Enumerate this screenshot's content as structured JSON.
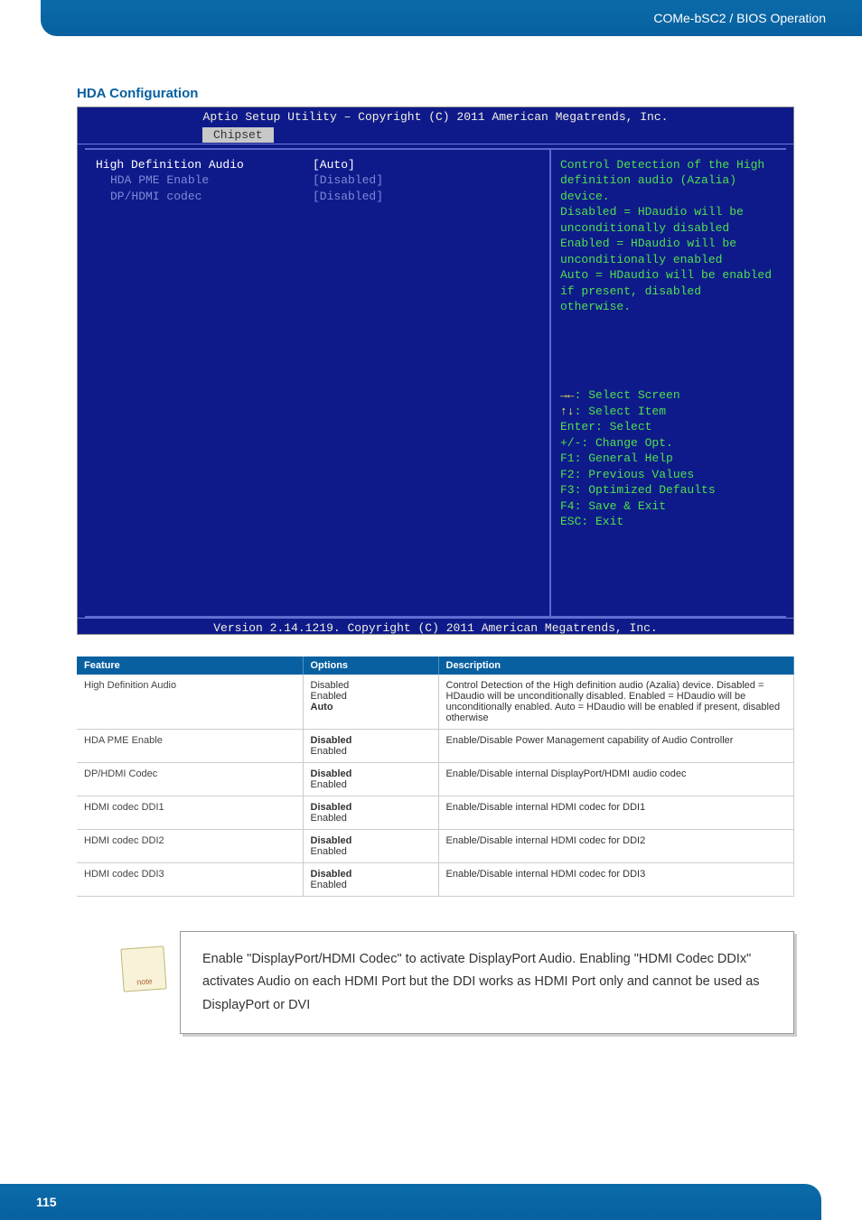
{
  "header": {
    "breadcrumb": "COMe-bSC2 / BIOS Operation"
  },
  "section_title": "HDA Configuration",
  "bios": {
    "top_bar": "Aptio Setup Utility – Copyright (C) 2011 American Megatrends, Inc.",
    "tab": "Chipset",
    "settings": [
      {
        "label": "High Definition Audio",
        "value": "[Auto]",
        "selected": true,
        "indent": false
      },
      {
        "label": "HDA PME Enable",
        "value": "[Disabled]",
        "selected": false,
        "indent": true
      },
      {
        "label": "DP/HDMI codec",
        "value": "[Disabled]",
        "selected": false,
        "indent": true
      }
    ],
    "help_top": [
      "Control Detection of the High",
      "definition audio (Azalia)",
      "device.",
      "Disabled = HDaudio will be",
      "unconditionally disabled",
      "Enabled = HDaudio will be",
      "unconditionally enabled",
      "Auto = HDaudio will be enabled",
      "if present, disabled otherwise."
    ],
    "help_bottom": [
      {
        "key": "→←",
        "txt": ": Select Screen",
        "keyclass": "yellow"
      },
      {
        "key": "↑↓",
        "txt": ": Select Item",
        "keyclass": "yellow"
      },
      {
        "key": "Enter",
        "txt": ": Select",
        "keyclass": "green"
      },
      {
        "key": "+/-",
        "txt": ": Change Opt.",
        "keyclass": "green"
      },
      {
        "key": "F1",
        "txt": ": General Help",
        "keyclass": "green"
      },
      {
        "key": "F2",
        "txt": ": Previous Values",
        "keyclass": "green"
      },
      {
        "key": "F3",
        "txt": ": Optimized Defaults",
        "keyclass": "green"
      },
      {
        "key": "F4",
        "txt": ": Save & Exit",
        "keyclass": "green"
      },
      {
        "key": "ESC",
        "txt": ": Exit",
        "keyclass": "green"
      }
    ],
    "footer": "Version 2.14.1219. Copyright (C) 2011 American Megatrends, Inc."
  },
  "table": {
    "headers": {
      "feature": "Feature",
      "options": "Options",
      "description": "Description"
    },
    "rows": [
      {
        "feature": "High Definition Audio",
        "options": [
          {
            "t": "Disabled",
            "b": false
          },
          {
            "t": "Enabled",
            "b": false
          },
          {
            "t": "Auto",
            "b": true
          }
        ],
        "description": "Control Detection of the High definition audio (Azalia) device. Disabled = HDaudio will be unconditionally disabled. Enabled = HDaudio will be unconditionally enabled. Auto = HDaudio will be enabled if present, disabled otherwise"
      },
      {
        "feature": "HDA PME Enable",
        "options": [
          {
            "t": "Disabled",
            "b": true
          },
          {
            "t": "Enabled",
            "b": false
          }
        ],
        "description": "Enable/Disable Power Management capability of Audio Controller"
      },
      {
        "feature": "DP/HDMI Codec",
        "options": [
          {
            "t": "Disabled",
            "b": true
          },
          {
            "t": "Enabled",
            "b": false
          }
        ],
        "description": "Enable/Disable internal DisplayPort/HDMI audio codec"
      },
      {
        "feature": "HDMI codec DDI1",
        "options": [
          {
            "t": "Disabled",
            "b": true
          },
          {
            "t": "Enabled",
            "b": false
          }
        ],
        "description": "Enable/Disable internal HDMI codec for DDI1"
      },
      {
        "feature": "HDMI codec DDI2",
        "options": [
          {
            "t": "Disabled",
            "b": true
          },
          {
            "t": "Enabled",
            "b": false
          }
        ],
        "description": "Enable/Disable internal HDMI codec for DDI2"
      },
      {
        "feature": "HDMI codec DDI3",
        "options": [
          {
            "t": "Disabled",
            "b": true
          },
          {
            "t": "Enabled",
            "b": false
          }
        ],
        "description": "Enable/Disable internal HDMI codec for DDI3"
      }
    ]
  },
  "note": {
    "icon_label": "note",
    "text": "Enable \"DisplayPort/HDMI Codec\" to activate DisplayPort Audio. Enabling \"HDMI Codec DDIx\" activates Audio on each HDMI Port but the DDI works as HDMI Port only and cannot be used as DisplayPort or DVI"
  },
  "footer": {
    "page_number": "115"
  }
}
